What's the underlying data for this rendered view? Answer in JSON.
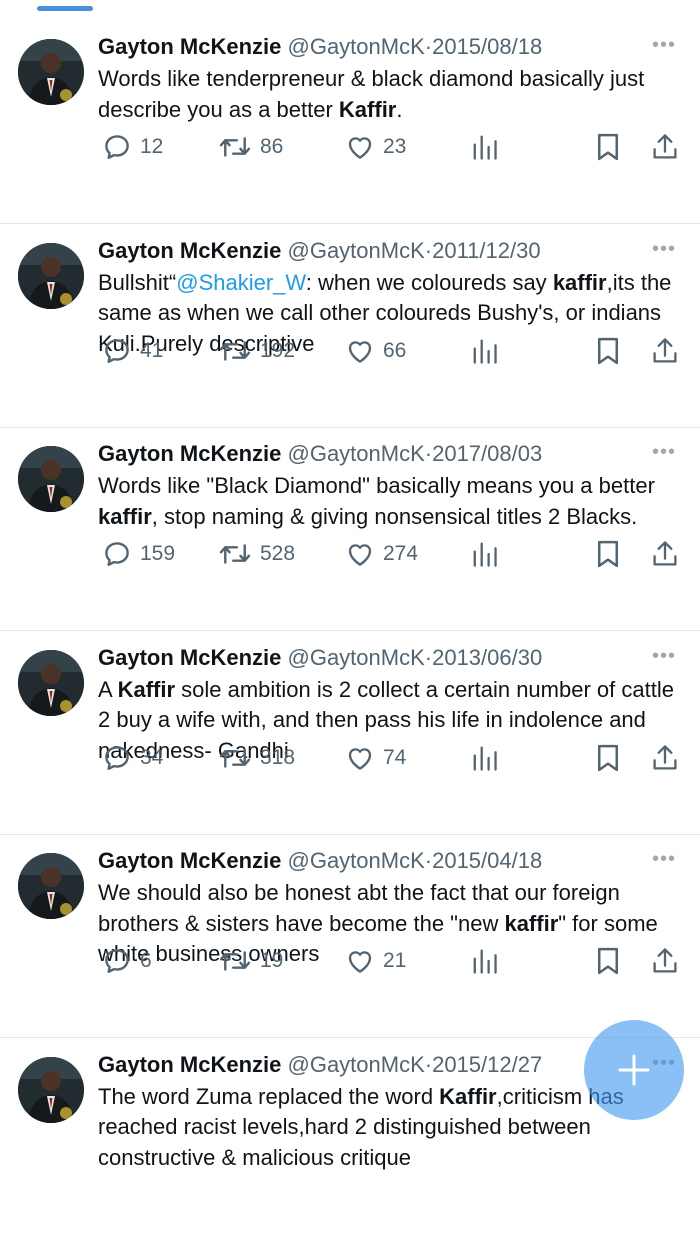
{
  "tweets": [
    {
      "name": "Gayton McKenzie",
      "handle": "@GaytonMcK",
      "sep": "·",
      "date": "2015/08/18",
      "body": [
        {
          "t": "Words like tenderpreneur & black diamond basically just describe you as a better "
        },
        {
          "t": "Kaffir",
          "b": true
        },
        {
          "t": "."
        }
      ],
      "replies": "12",
      "retweets": "86",
      "likes": "23"
    },
    {
      "name": "Gayton McKenzie",
      "handle": "@GaytonMcK",
      "sep": "·",
      "date": "2011/12/30",
      "body": [
        {
          "t": "Bullshit“"
        },
        {
          "t": "@Shakier_W",
          "m": true
        },
        {
          "t": ": when we coloureds say "
        },
        {
          "t": "kaffir",
          "b": true
        },
        {
          "t": ",its the same as when we call other coloureds Bushy's, or indians Kuli.Purely descriptive"
        }
      ],
      "replies": "41",
      "retweets": "192",
      "likes": "66"
    },
    {
      "name": "Gayton McKenzie",
      "handle": "@GaytonMcK",
      "sep": "·",
      "date": "2017/08/03",
      "body": [
        {
          "t": "Words like \"Black Diamond\"  basically means you a better "
        },
        {
          "t": "kaffir",
          "b": true
        },
        {
          "t": ", stop naming & giving nonsensical titles 2 Blacks."
        }
      ],
      "replies": "159",
      "retweets": "528",
      "likes": "274"
    },
    {
      "name": "Gayton McKenzie",
      "handle": "@GaytonMcK",
      "sep": "·",
      "date": "2013/06/30",
      "body": [
        {
          "t": "A "
        },
        {
          "t": "Kaffir",
          "b": true
        },
        {
          "t": " sole ambition is 2 collect a certain number of cattle 2 buy a wife with, and then pass his life in indolence and nakedness- Gandhi"
        }
      ],
      "replies": "34",
      "retweets": "318",
      "likes": "74"
    },
    {
      "name": "Gayton McKenzie",
      "handle": "@GaytonMcK",
      "sep": "·",
      "date": "2015/04/18",
      "body": [
        {
          "t": "We should also be honest abt the fact that our foreign brothers & sisters have become the \"new "
        },
        {
          "t": "kaffir",
          "b": true
        },
        {
          "t": "\" for some white business owners"
        }
      ],
      "replies": "6",
      "retweets": "19",
      "likes": "21"
    },
    {
      "name": "Gayton McKenzie",
      "handle": "@GaytonMcK",
      "sep": "·",
      "date": "2015/12/27",
      "body": [
        {
          "t": "The word Zuma replaced the word "
        },
        {
          "t": "Kaffir",
          "b": true
        },
        {
          "t": ",criticism has reached racist levels,hard 2 distinguished between constructive & malicious critique"
        }
      ],
      "replies": "",
      "retweets": "",
      "likes": ""
    }
  ],
  "icons": {
    "more": "more-icon",
    "reply": "reply-icon",
    "retweet": "retweet-icon",
    "like": "like-icon",
    "views": "views-icon",
    "bookmark": "bookmark-icon",
    "share": "share-icon",
    "compose": "compose-plus-icon"
  },
  "colors": {
    "text": "#0f1419",
    "meta": "#536471",
    "mention": "#1d9bf0",
    "fab": "#429af0"
  },
  "more_glyph": "•••"
}
